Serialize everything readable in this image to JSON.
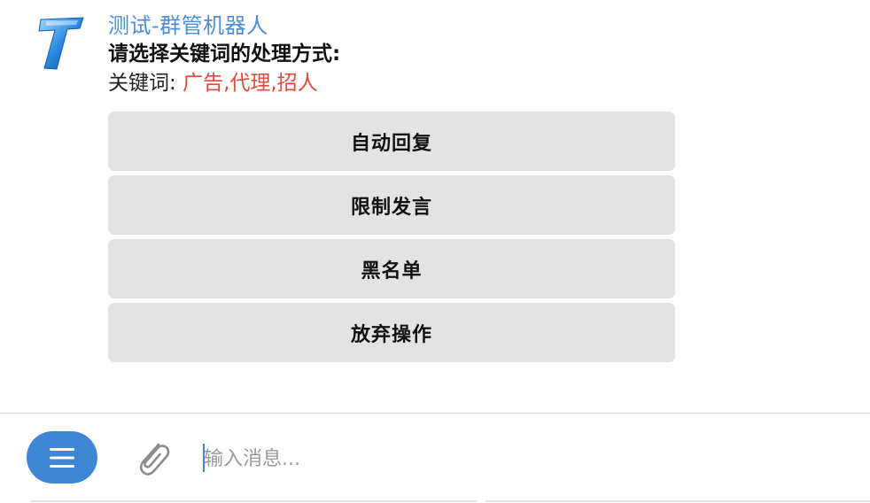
{
  "message": {
    "bot_name": "测试-群管机器人",
    "title": "请选择关键词的处理方式:",
    "keywords_label": "关键词:",
    "keywords_values": "广告,代理,招人"
  },
  "keyboard": {
    "buttons": [
      {
        "label": "自动回复"
      },
      {
        "label": "限制发言"
      },
      {
        "label": "黑名单"
      },
      {
        "label": "放弃操作"
      }
    ]
  },
  "composer": {
    "placeholder": "输入消息..."
  },
  "colors": {
    "bot_name": "#4a90d9",
    "keyword_values": "#e5493a",
    "button_bg": "#e3e3e3",
    "menu_button": "#3f86d4"
  },
  "icons": {
    "avatar": "bot-avatar-icon",
    "menu": "menu-icon",
    "attach": "paperclip-icon"
  }
}
